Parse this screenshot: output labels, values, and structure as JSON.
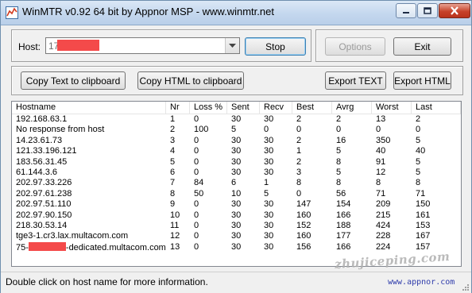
{
  "window": {
    "title": "WinMTR v0.92 64 bit by Appnor MSP - www.winmtr.net"
  },
  "host_panel": {
    "host_label": "Host:",
    "host_value": "17",
    "stop_label": "Stop"
  },
  "side_panel": {
    "options_label": "Options",
    "exit_label": "Exit"
  },
  "export_panel": {
    "copy_text_label": "Copy Text to clipboard",
    "copy_html_label": "Copy HTML to clipboard",
    "export_text_label": "Export TEXT",
    "export_html_label": "Export HTML"
  },
  "table": {
    "columns": [
      "Hostname",
      "Nr",
      "Loss %",
      "Sent",
      "Recv",
      "Best",
      "Avrg",
      "Worst",
      "Last"
    ],
    "rows": [
      {
        "host": "192.168.63.1",
        "nr": "1",
        "loss": "0",
        "sent": "30",
        "recv": "30",
        "best": "2",
        "avrg": "2",
        "worst": "13",
        "last": "2"
      },
      {
        "host": "No response from host",
        "nr": "2",
        "loss": "100",
        "sent": "5",
        "recv": "0",
        "best": "0",
        "avrg": "0",
        "worst": "0",
        "last": "0"
      },
      {
        "host": "14.23.61.73",
        "nr": "3",
        "loss": "0",
        "sent": "30",
        "recv": "30",
        "best": "2",
        "avrg": "16",
        "worst": "350",
        "last": "5"
      },
      {
        "host": "121.33.196.121",
        "nr": "4",
        "loss": "0",
        "sent": "30",
        "recv": "30",
        "best": "1",
        "avrg": "5",
        "worst": "40",
        "last": "40"
      },
      {
        "host": "183.56.31.45",
        "nr": "5",
        "loss": "0",
        "sent": "30",
        "recv": "30",
        "best": "2",
        "avrg": "8",
        "worst": "91",
        "last": "5"
      },
      {
        "host": "61.144.3.6",
        "nr": "6",
        "loss": "0",
        "sent": "30",
        "recv": "30",
        "best": "3",
        "avrg": "5",
        "worst": "12",
        "last": "5"
      },
      {
        "host": "202.97.33.226",
        "nr": "7",
        "loss": "84",
        "sent": "6",
        "recv": "1",
        "best": "8",
        "avrg": "8",
        "worst": "8",
        "last": "8"
      },
      {
        "host": "202.97.61.238",
        "nr": "8",
        "loss": "50",
        "sent": "10",
        "recv": "5",
        "best": "0",
        "avrg": "56",
        "worst": "71",
        "last": "71"
      },
      {
        "host": "202.97.51.110",
        "nr": "9",
        "loss": "0",
        "sent": "30",
        "recv": "30",
        "best": "147",
        "avrg": "154",
        "worst": "209",
        "last": "150"
      },
      {
        "host": "202.97.90.150",
        "nr": "10",
        "loss": "0",
        "sent": "30",
        "recv": "30",
        "best": "160",
        "avrg": "166",
        "worst": "215",
        "last": "161"
      },
      {
        "host": "218.30.53.14",
        "nr": "11",
        "loss": "0",
        "sent": "30",
        "recv": "30",
        "best": "152",
        "avrg": "188",
        "worst": "424",
        "last": "153"
      },
      {
        "host": "tge3-1.cr3.lax.multacom.com",
        "nr": "12",
        "loss": "0",
        "sent": "30",
        "recv": "30",
        "best": "160",
        "avrg": "177",
        "worst": "228",
        "last": "167"
      },
      {
        "host": "75-",
        "host_suffix": "-dedicated.multacom.com",
        "nr": "13",
        "loss": "0",
        "sent": "30",
        "recv": "30",
        "best": "156",
        "avrg": "166",
        "worst": "224",
        "last": "157"
      }
    ]
  },
  "status": {
    "message": "Double click on host name for more information.",
    "url": "www.appnor.com"
  },
  "watermark": "zhujiceping.com",
  "colors": {
    "redaction": "#f44a4a",
    "status_url": "#2f3cab"
  }
}
